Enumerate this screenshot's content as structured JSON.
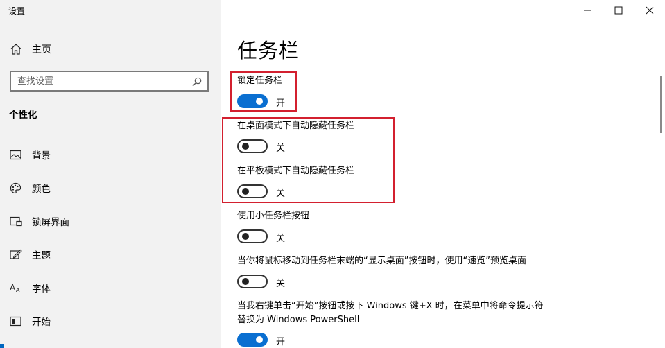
{
  "window": {
    "title": "设置"
  },
  "sidebar": {
    "home_label": "主页",
    "search_placeholder": "查找设置",
    "section_title": "个性化",
    "items": [
      {
        "label": "背景",
        "icon": "image-icon"
      },
      {
        "label": "颜色",
        "icon": "palette-icon"
      },
      {
        "label": "锁屏界面",
        "icon": "lock-screen-icon"
      },
      {
        "label": "主题",
        "icon": "theme-icon"
      },
      {
        "label": "字体",
        "icon": "font-icon"
      },
      {
        "label": "开始",
        "icon": "start-icon"
      }
    ]
  },
  "main": {
    "title": "任务栏",
    "settings": [
      {
        "label": "锁定任务栏",
        "state": "开",
        "on": true
      },
      {
        "label": "在桌面模式下自动隐藏任务栏",
        "state": "关",
        "on": false
      },
      {
        "label": "在平板模式下自动隐藏任务栏",
        "state": "关",
        "on": false
      },
      {
        "label": "使用小任务栏按钮",
        "state": "关",
        "on": false
      },
      {
        "label": "当你将鼠标移动到任务栏末端的“显示桌面”按钮时，使用“速览”预览桌面",
        "state": "关",
        "on": false
      },
      {
        "label": "当我右键单击“开始”按钮或按下 Windows 键+X 时，在菜单中将命令提示符替换为 Windows PowerShell",
        "state": "开",
        "on": true
      }
    ]
  },
  "colors": {
    "accent": "#0a6fd1",
    "highlight_box": "#d3202f",
    "sidebar_bg": "#f2f2f2"
  }
}
